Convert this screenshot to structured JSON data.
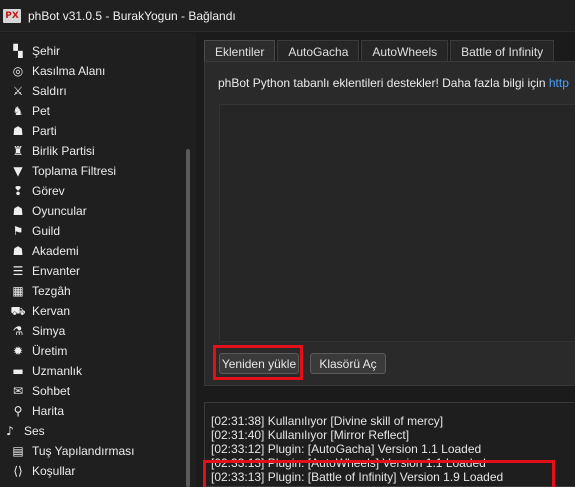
{
  "window": {
    "app_icon_text": "PX",
    "title": "phBot v31.0.5 - BurakYogun - Bağlandı"
  },
  "sidebar": {
    "items": [
      {
        "label": "Şehir",
        "icon": "city-icon",
        "glyph": "▚"
      },
      {
        "label": "Kasılma Alanı",
        "icon": "target-icon",
        "glyph": "◎"
      },
      {
        "label": "Saldırı",
        "icon": "sword-icon",
        "glyph": "⚔"
      },
      {
        "label": "Pet",
        "icon": "dog-icon",
        "glyph": "♞"
      },
      {
        "label": "Parti",
        "icon": "party-icon",
        "glyph": "☗"
      },
      {
        "label": "Birlik Partisi",
        "icon": "union-party-icon",
        "glyph": "♜"
      },
      {
        "label": "Toplama Filtresi",
        "icon": "filter-icon",
        "glyph": "▼"
      },
      {
        "label": "Görev",
        "icon": "quest-icon",
        "glyph": "❢"
      },
      {
        "label": "Oyuncular",
        "icon": "players-icon",
        "glyph": "☗"
      },
      {
        "label": "Guild",
        "icon": "guild-icon",
        "glyph": "⚑"
      },
      {
        "label": "Akademi",
        "icon": "academy-icon",
        "glyph": "☗"
      },
      {
        "label": "Envanter",
        "icon": "inventory-icon",
        "glyph": "☰"
      },
      {
        "label": "Tezgâh",
        "icon": "stall-icon",
        "glyph": "▦"
      },
      {
        "label": "Kervan",
        "icon": "caravan-icon",
        "glyph": "⛟"
      },
      {
        "label": "Simya",
        "icon": "alchemy-icon",
        "glyph": "⚗"
      },
      {
        "label": "Üretim",
        "icon": "production-icon",
        "glyph": "✹"
      },
      {
        "label": "Uzmanlık",
        "icon": "specialty-icon",
        "glyph": "▬"
      },
      {
        "label": "Sohbet",
        "icon": "chat-icon",
        "glyph": "✉"
      },
      {
        "label": "Harita",
        "icon": "map-pin-icon",
        "glyph": "⚲"
      },
      {
        "label": "Ses",
        "icon": "bell-icon",
        "glyph": "♪"
      },
      {
        "label": "Tuş Yapılandırması",
        "icon": "keyboard-icon",
        "glyph": "▤"
      },
      {
        "label": "Koşullar",
        "icon": "code-icon",
        "glyph": "⟨⟩"
      }
    ]
  },
  "tabs": [
    {
      "label": "Eklentiler",
      "active": true
    },
    {
      "label": "AutoGacha"
    },
    {
      "label": "AutoWheels"
    },
    {
      "label": "Battle of Infinity"
    }
  ],
  "plugins_panel": {
    "info_text": "phBot Python tabanlı eklentileri destekler! Daha fazla bilgi için ",
    "info_link": "http",
    "reload_button": "Yeniden yükle",
    "folder_button": "Klasörü Aç"
  },
  "log": [
    "[02:31:38] Kullanılıyor [Divine skill of mercy]",
    "[02:31:40] Kullanılıyor [Mirror Reflect]",
    "[02:33:12] Plugin: [AutoGacha] Version 1.1 Loaded",
    "[02:33:13] Plugin: [AutoWheels] Version 1.1 Loaded",
    "[02:33:13] Plugin: [Battle of Infinity] Version 1.9 Loaded"
  ],
  "colors": {
    "highlight": "#e3101c",
    "link": "#4aa3ff"
  }
}
